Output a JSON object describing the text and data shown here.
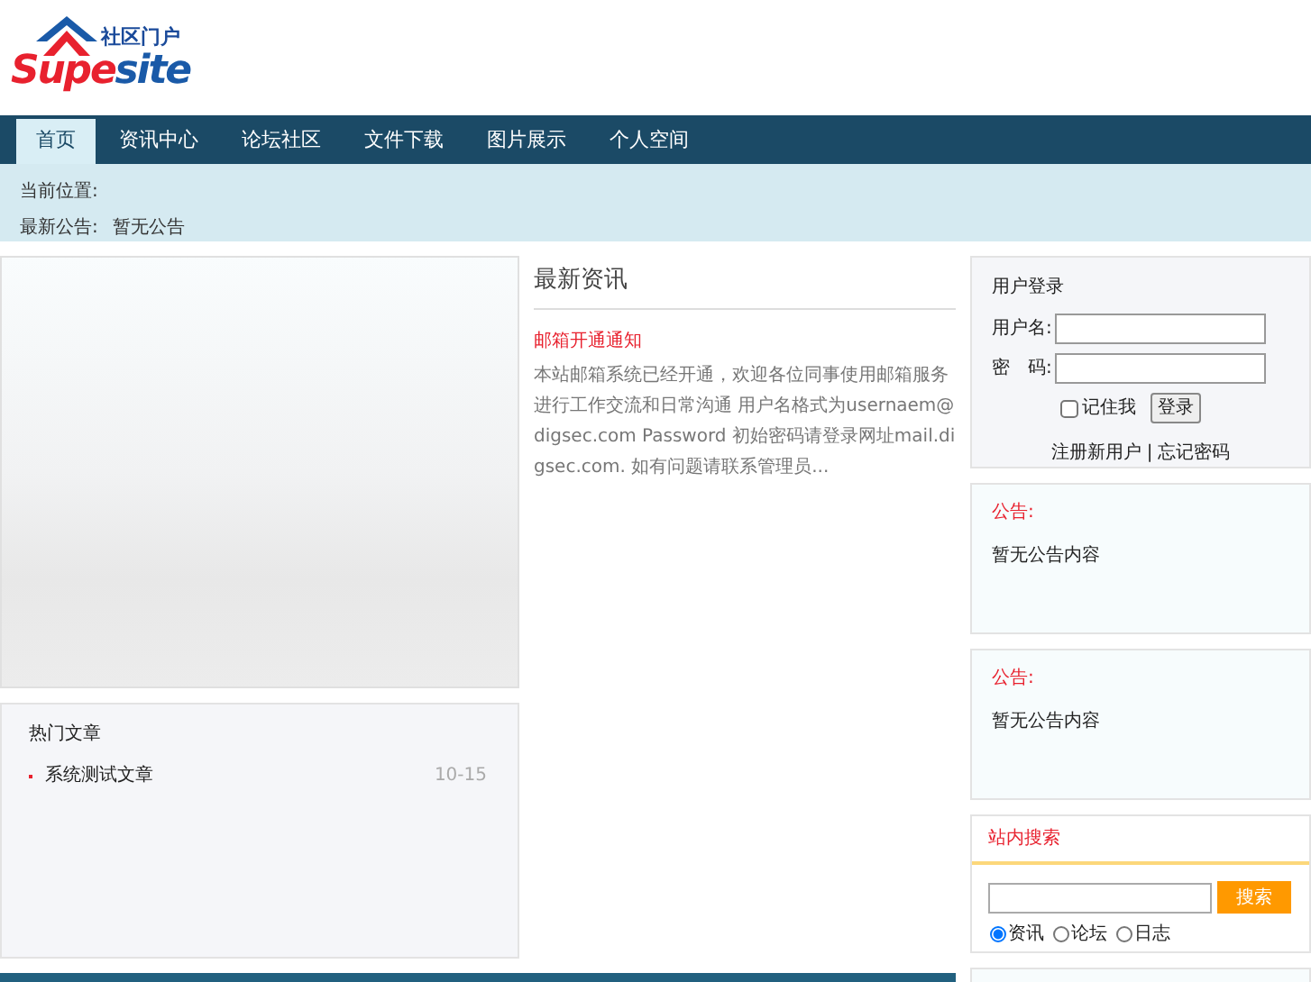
{
  "logo": {
    "tagline": "社区门户",
    "brand_red": "Supe",
    "brand_blue": "site"
  },
  "nav": [
    {
      "label": "首页",
      "selected": true
    },
    {
      "label": "资讯中心",
      "selected": false
    },
    {
      "label": "论坛社区",
      "selected": false
    },
    {
      "label": "文件下载",
      "selected": false
    },
    {
      "label": "图片展示",
      "selected": false
    },
    {
      "label": "个人空间",
      "selected": false
    }
  ],
  "location": {
    "label": "当前位置:"
  },
  "notice_line": {
    "label": "最新公告:",
    "value": "暂无公告"
  },
  "hot": {
    "title": "热门文章",
    "items": [
      {
        "title": "系统测试文章",
        "date": "10-15"
      }
    ]
  },
  "news": {
    "title": "最新资讯",
    "headline": "邮箱开通通知",
    "body": "本站邮箱系统已经开通，欢迎各位同事使用邮箱服务进行工作交流和日常沟通 用户名格式为usernaem@digsec.com  Password 初始密码请登录网址mail.digsec.com. 如有问题请联系管理员..."
  },
  "login": {
    "title": "用户登录",
    "user_label": "用户名:",
    "pass_label": "密　码:",
    "remember": "记住我",
    "remember_checked": false,
    "submit": "登录",
    "register": "注册新用户",
    "separator": "|",
    "forgot": "忘记密码"
  },
  "notices": [
    {
      "title": "公告:",
      "text": "暂无公告内容"
    },
    {
      "title": "公告:",
      "text": "暂无公告内容"
    }
  ],
  "search": {
    "title": "站内搜索",
    "button": "搜索",
    "options": [
      {
        "label": "资讯",
        "selected": true
      },
      {
        "label": "论坛",
        "selected": false
      },
      {
        "label": "日志",
        "selected": false
      }
    ]
  }
}
